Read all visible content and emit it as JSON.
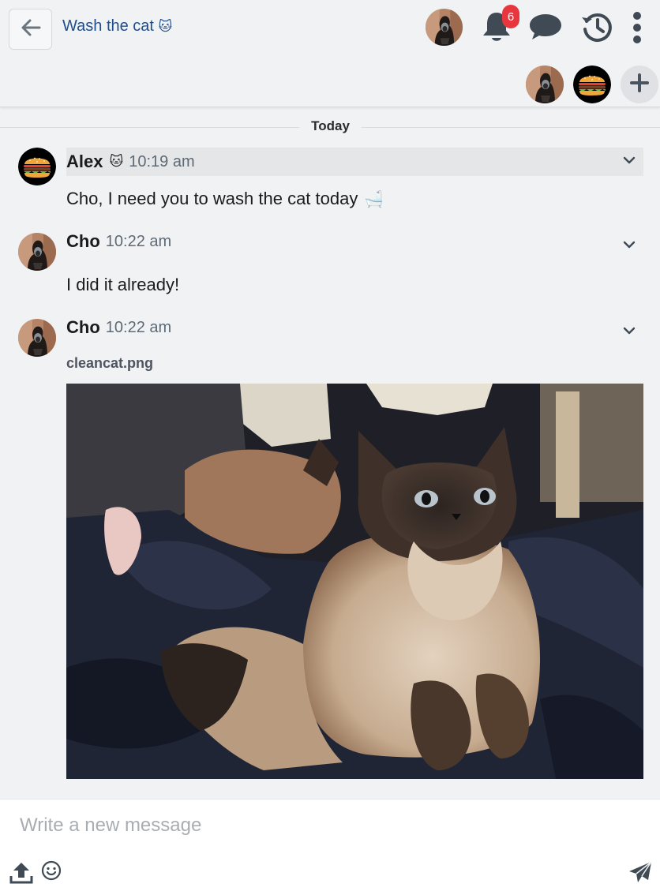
{
  "header": {
    "title": "Wash the cat",
    "title_emoji": "🐱",
    "notification_count": "6",
    "icons": [
      "back-arrow-icon",
      "bell-icon",
      "chat-bubble-icon",
      "history-icon",
      "more-vertical-icon",
      "plus-icon"
    ]
  },
  "divider": {
    "label": "Today"
  },
  "messages": [
    {
      "author": "Alex",
      "author_emoji": "🐱",
      "time": "10:19 am",
      "text": "Cho, I need you to wash the cat today",
      "text_emoji": "🛁"
    },
    {
      "author": "Cho",
      "time": "10:22 am",
      "text": "I did it already!"
    },
    {
      "author": "Cho",
      "time": "10:22 am",
      "attachment_name": "cleancat.png"
    }
  ],
  "composer": {
    "placeholder": "Write a new message"
  },
  "colors": {
    "accent": "#1f4e8c",
    "badge": "#e8363f",
    "background": "#f1f2f4",
    "highlight": "#e5e6e8"
  }
}
